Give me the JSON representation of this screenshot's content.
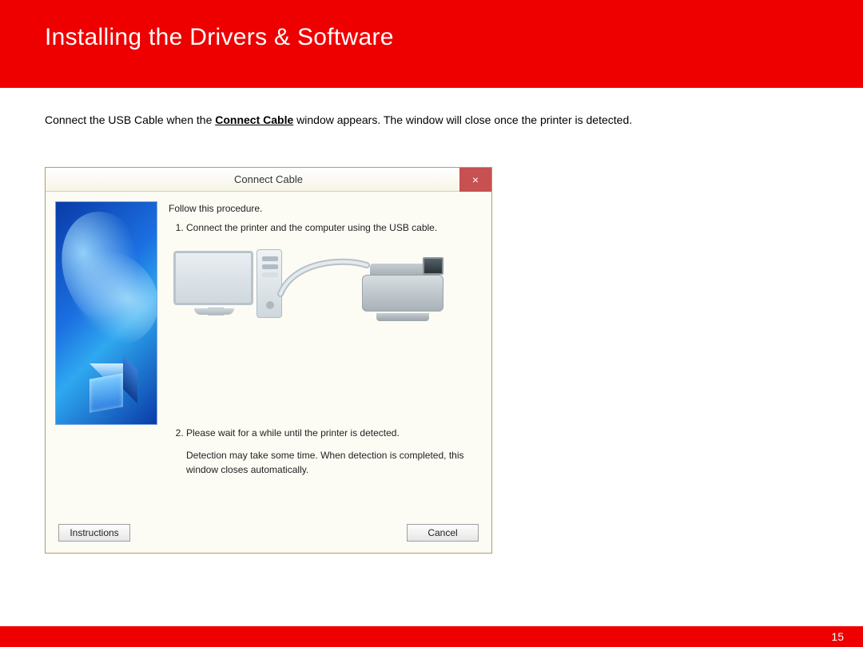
{
  "header": {
    "title": "Installing  the Drivers & Software"
  },
  "instruction": {
    "pre": "Connect the USB Cable when the ",
    "bold": "Connect Cable",
    "post": " window appears.  The window will close once the printer is detected."
  },
  "dialog": {
    "title": "Connect Cable",
    "close_glyph": "×",
    "lead": "Follow this procedure.",
    "step1": "Connect the printer and the computer using the USB cable.",
    "step2": "Please wait for a while until the printer is detected.",
    "note": "Detection may take some time. When detection is completed, this window closes automatically.",
    "buttons": {
      "instructions": "Instructions",
      "cancel": "Cancel"
    }
  },
  "page_number": "15"
}
